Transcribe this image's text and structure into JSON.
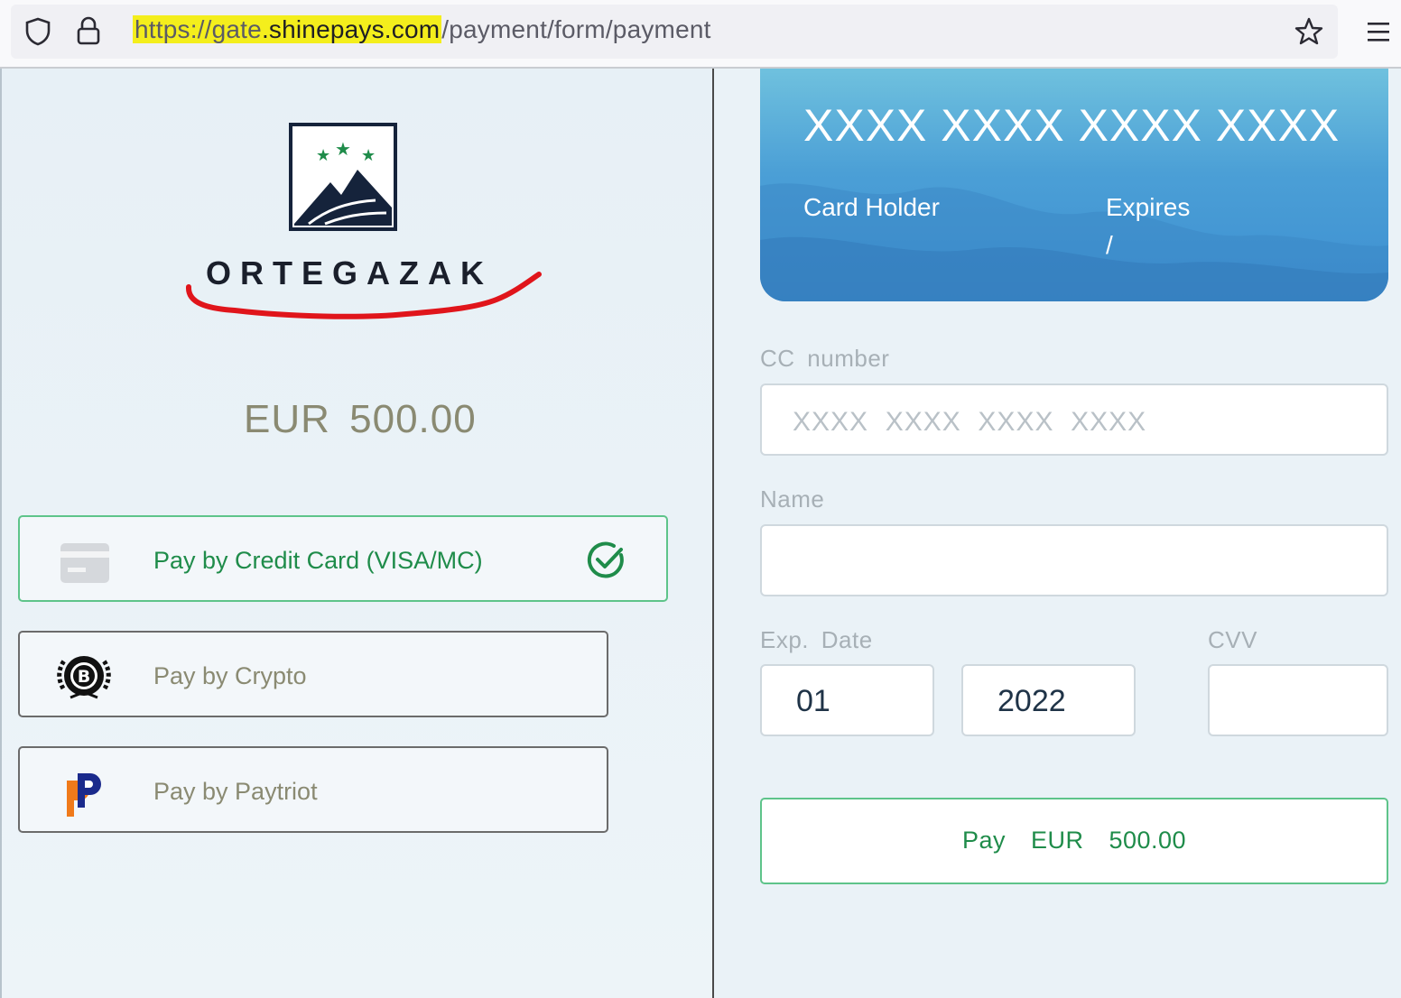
{
  "browser": {
    "url_highlighted_prefix": "https://gate",
    "url_highlighted_domain": ".shinepays.com",
    "url_path": "/payment/form/payment",
    "icons": [
      "shield-icon",
      "lock-icon",
      "star-icon",
      "hamburger-menu-icon"
    ]
  },
  "merchant": {
    "name": "ORTEGAZAK",
    "amount": "EUR  500.00"
  },
  "payment_methods": [
    {
      "label": "Pay by Credit Card (VISA/MC)",
      "icon": "credit-card-icon",
      "selected": true
    },
    {
      "label": "Pay by Crypto",
      "icon": "bitcoin-icon",
      "selected": false
    },
    {
      "label": "Pay by Paytriot",
      "icon": "paytriot-icon",
      "selected": false
    }
  ],
  "card_preview": {
    "number": "XXXX XXXX XXXX XXXX",
    "holder_label": "Card Holder",
    "expires_label": "Expires",
    "expires_value": "/"
  },
  "form": {
    "cc_label": "CC  number",
    "cc_placeholder": "XXXX  XXXX  XXXX  XXXX",
    "name_label": "Name",
    "name_value": "",
    "exp_label": "Exp.  Date",
    "exp_month": "01",
    "exp_year": "2022",
    "cvv_label": "CVV",
    "cvv_value": "",
    "pay_button": "Pay  EUR  500.00"
  },
  "colors": {
    "accent_green": "#1f8c4a",
    "highlight_yellow": "#f4ee1c",
    "annotation_red": "#e0151b",
    "card_blue": "#4b9fd6"
  }
}
